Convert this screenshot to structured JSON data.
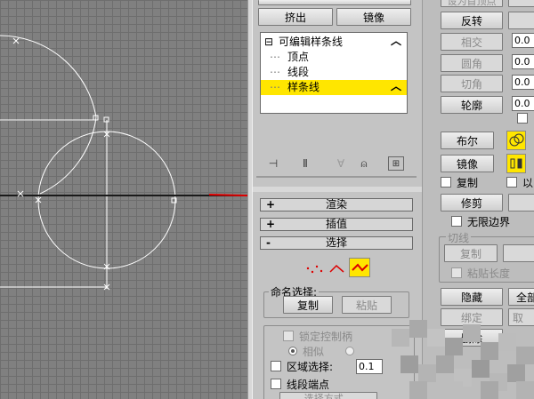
{
  "stack": {
    "top_buttons": [
      "挤出",
      "镜像"
    ],
    "root_label": "可编辑样条线",
    "items": [
      "顶点",
      "线段",
      "样条线"
    ],
    "selected": "样条线"
  },
  "rollouts": [
    {
      "sign": "+",
      "label": "渲染"
    },
    {
      "sign": "+",
      "label": "插值"
    },
    {
      "sign": "-",
      "label": "选择"
    }
  ],
  "named_selection": {
    "title": "命名选择:",
    "copy_label": "复制",
    "paste_label": "粘贴"
  },
  "selection_options": {
    "lock_handles": "锁定控制柄",
    "similar": "相似",
    "area_select": "区域选择:",
    "area_value": "0.1",
    "segment_end": "线段端点",
    "select_by": "选择方式..."
  },
  "right_panel": {
    "top_partial": "设为首顶点",
    "reverse": "反转",
    "intersect": "相交",
    "fillet": "圆角",
    "chamfer": "切角",
    "outline": "轮廓",
    "boolean": "布尔",
    "mirror": "镜像",
    "copy_check": "复制",
    "about_pivot": "以",
    "trim": "修剪",
    "infinite_bounds": "无限边界",
    "tangent_group": "切线",
    "tangent_copy": "复制",
    "paste_length": "粘贴长度",
    "hide": "隐藏",
    "unhide_all": "全部",
    "bind": "绑定",
    "unbind": "取",
    "delete_partial": "删除",
    "field_values": [
      "0.0",
      "0.0",
      "0.0",
      "0.0"
    ]
  },
  "colors": {
    "selection_highlight": "#ffe600",
    "arrow": "#e00000",
    "viewport_bg": "#808080",
    "spline_color": "#ffffff"
  }
}
